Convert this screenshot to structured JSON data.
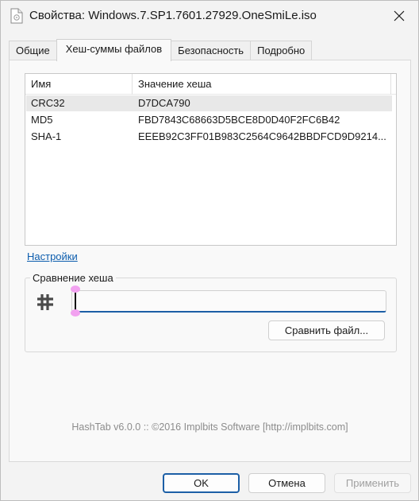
{
  "window": {
    "title": "Свойства: Windows.7.SP1.7601.27929.OneSmiLe.iso",
    "close_glyph": "✕"
  },
  "tabs": [
    {
      "label": "Общие",
      "active": false
    },
    {
      "label": "Хеш-суммы файлов",
      "active": true
    },
    {
      "label": "Безопасность",
      "active": false
    },
    {
      "label": "Подробно",
      "active": false
    }
  ],
  "hash_table": {
    "columns": [
      "Имя",
      "Значение хеша"
    ],
    "rows": [
      {
        "name": "CRC32",
        "value": "D7DCA790",
        "selected": true
      },
      {
        "name": "MD5",
        "value": "FBD7843C68663D5BCE8D0D40F2FC6B42",
        "selected": false
      },
      {
        "name": "SHA-1",
        "value": "EEEB92C3FF01B983C2564C9642BBDFCD9D9214...",
        "selected": false
      }
    ]
  },
  "settings_link": "Настройки",
  "comparison": {
    "group_title": "Сравнение хеша",
    "input_value": "",
    "compare_button": "Сравнить файл..."
  },
  "credit": "HashTab v6.0.0 :: ©2016 Implbits Software [http://implbits.com]",
  "buttons": {
    "ok": "OK",
    "cancel": "Отмена",
    "apply": "Применить"
  },
  "colors": {
    "link": "#0b5cad",
    "accent": "#1c5fa6",
    "selected_row": "#e8e8e8",
    "caret_marker": "#f2a2f0"
  }
}
